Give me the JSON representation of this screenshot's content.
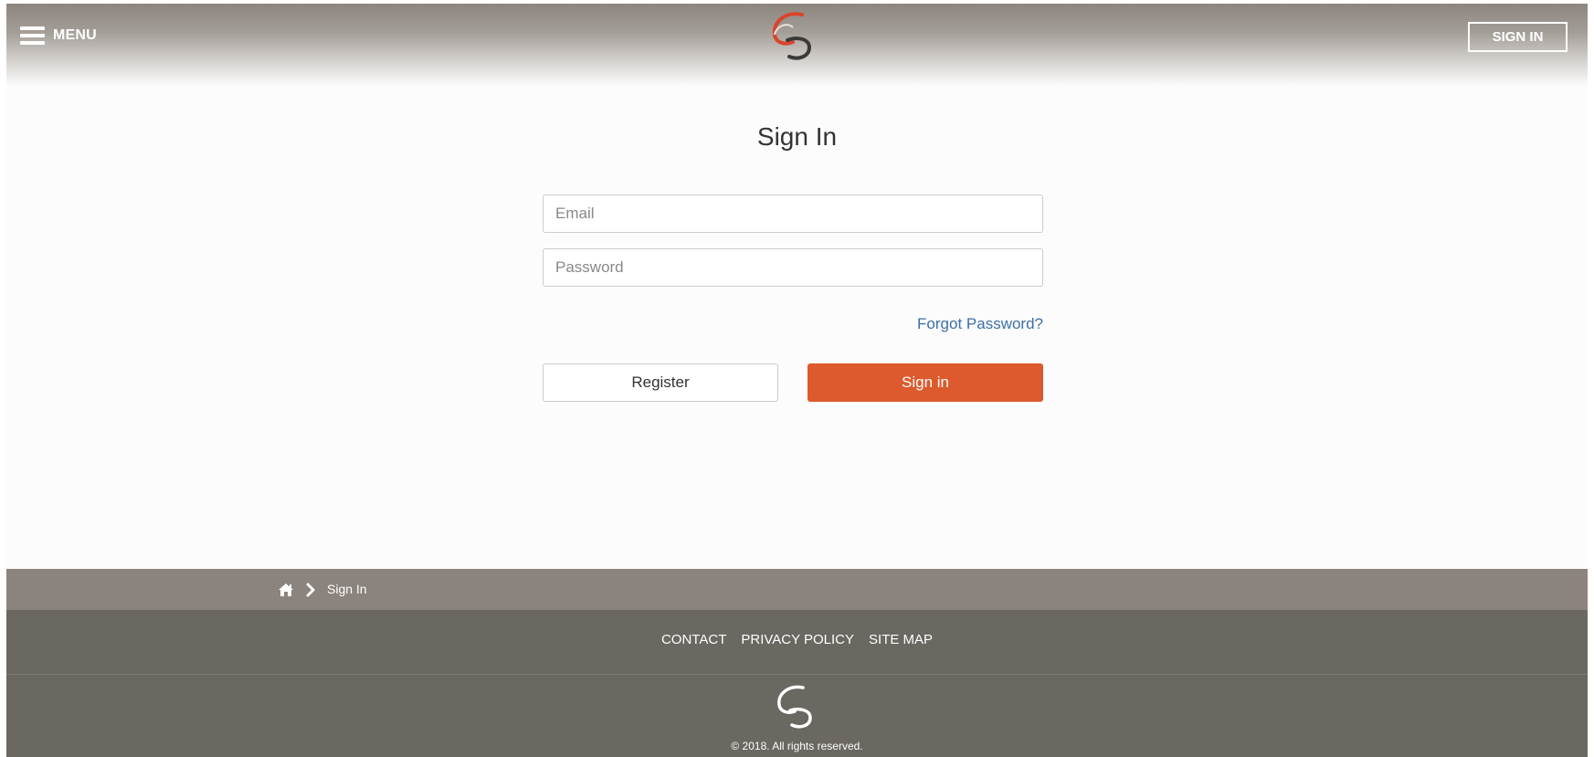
{
  "header": {
    "menu_label": "MENU",
    "signin_label": "SIGN IN",
    "logo_icon": "swirl-logo-icon"
  },
  "form": {
    "title": "Sign In",
    "email_placeholder": "Email",
    "password_placeholder": "Password",
    "forgot_label": "Forgot Password?",
    "register_label": "Register",
    "signin_label": "Sign in"
  },
  "breadcrumb": {
    "home_icon": "home-icon",
    "separator_icon": "chevron-right-icon",
    "current": "Sign In"
  },
  "footer": {
    "links": [
      "CONTACT",
      "PRIVACY POLICY",
      "SITE MAP"
    ],
    "copyright": "© 2018. All rights reserved."
  },
  "colors": {
    "accent": "#dc5a2d",
    "link": "#3d6fa8",
    "breadcrumb_bg": "#8b837d",
    "footer_bg": "#6b6761"
  }
}
